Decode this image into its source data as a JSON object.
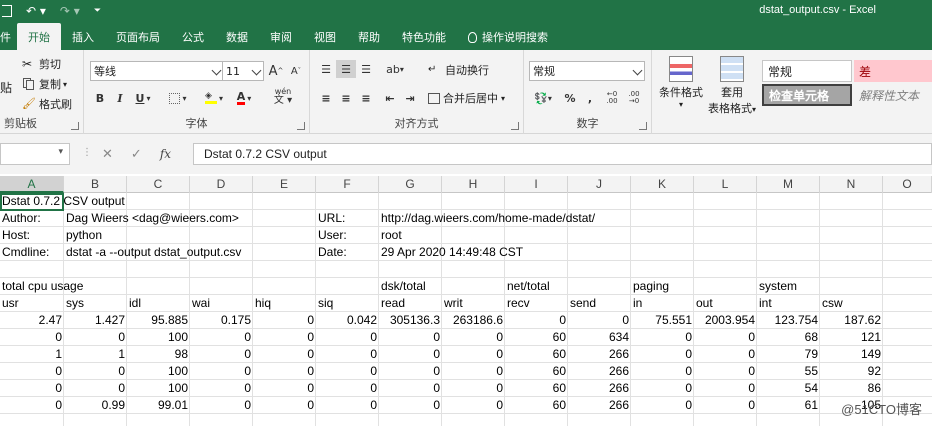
{
  "app": {
    "window_title": "dstat_output.csv - Excel",
    "qat_save_icon": "save-icon",
    "qat_undo_icon": "undo-icon",
    "qat_redo_icon": "redo-icon"
  },
  "tabs": [
    "件",
    "开始",
    "插入",
    "页面布局",
    "公式",
    "数据",
    "审阅",
    "视图",
    "帮助",
    "特色功能",
    "操作说明搜索"
  ],
  "ribbon": {
    "clipboard": {
      "paste": "贴",
      "cut": "剪切",
      "copy": "复制",
      "format_painter": "格式刷",
      "label": "剪贴板"
    },
    "font": {
      "name": "等线",
      "size": "11",
      "grow": "A",
      "shrink": "A",
      "bold": "B",
      "italic": "I",
      "underline": "U",
      "font_color_letter": "A",
      "wen": "wén",
      "label": "字体"
    },
    "alignment": {
      "wrap": "自动换行",
      "merge": "合并后居中",
      "label": "对齐方式"
    },
    "number": {
      "format": "常规",
      "percent": "%",
      "comma": ",",
      "label": "数字"
    },
    "styles": {
      "conditional": "条件格式",
      "table_format_1": "套用",
      "table_format_2": "表格格式",
      "normal": "常规",
      "bad": "差",
      "check_cell": "检查单元格",
      "explanatory": "解释性文本"
    }
  },
  "formula_bar": {
    "fx": "fx",
    "cancel": "✕",
    "enter": "✓",
    "content": "Dstat 0.7.2 CSV output"
  },
  "columns": [
    "A",
    "B",
    "C",
    "D",
    "E",
    "F",
    "G",
    "H",
    "I",
    "J",
    "K",
    "L",
    "M",
    "N",
    "O"
  ],
  "rows": [
    {
      "cells": [
        {
          "c": 0,
          "t": "Dstat 0.7.2 CSV output"
        }
      ]
    },
    {
      "cells": [
        {
          "c": 0,
          "t": "Author:"
        },
        {
          "c": 1,
          "t": "Dag Wieers <dag@wieers.com>"
        },
        {
          "c": 5,
          "t": "URL:"
        },
        {
          "c": 6,
          "t": "http://dag.wieers.com/home-made/dstat/"
        }
      ]
    },
    {
      "cells": [
        {
          "c": 0,
          "t": "Host:"
        },
        {
          "c": 1,
          "t": "python"
        },
        {
          "c": 5,
          "t": "User:"
        },
        {
          "c": 6,
          "t": "root"
        }
      ]
    },
    {
      "cells": [
        {
          "c": 0,
          "t": "Cmdline:"
        },
        {
          "c": 1,
          "t": "dstat -a --output dstat_output.csv"
        },
        {
          "c": 5,
          "t": "Date:"
        },
        {
          "c": 6,
          "t": "29 Apr 2020 14:49:48 CST"
        }
      ]
    },
    {
      "cells": []
    },
    {
      "cells": [
        {
          "c": 0,
          "t": "total cpu usage"
        },
        {
          "c": 6,
          "t": "dsk/total"
        },
        {
          "c": 8,
          "t": "net/total"
        },
        {
          "c": 10,
          "t": "paging"
        },
        {
          "c": 12,
          "t": "system"
        }
      ]
    },
    {
      "cells": [
        {
          "c": 0,
          "t": "usr"
        },
        {
          "c": 1,
          "t": "sys"
        },
        {
          "c": 2,
          "t": "idl"
        },
        {
          "c": 3,
          "t": "wai"
        },
        {
          "c": 4,
          "t": "hiq"
        },
        {
          "c": 5,
          "t": "siq"
        },
        {
          "c": 6,
          "t": "read"
        },
        {
          "c": 7,
          "t": "writ"
        },
        {
          "c": 8,
          "t": "recv"
        },
        {
          "c": 9,
          "t": "send"
        },
        {
          "c": 10,
          "t": "in"
        },
        {
          "c": 11,
          "t": "out"
        },
        {
          "c": 12,
          "t": "int"
        },
        {
          "c": 13,
          "t": "csw"
        }
      ]
    },
    {
      "num": true,
      "cells": [
        {
          "c": 0,
          "t": "2.47"
        },
        {
          "c": 1,
          "t": "1.427"
        },
        {
          "c": 2,
          "t": "95.885"
        },
        {
          "c": 3,
          "t": "0.175"
        },
        {
          "c": 4,
          "t": "0"
        },
        {
          "c": 5,
          "t": "0.042"
        },
        {
          "c": 6,
          "t": "305136.3"
        },
        {
          "c": 7,
          "t": "263186.6"
        },
        {
          "c": 8,
          "t": "0"
        },
        {
          "c": 9,
          "t": "0"
        },
        {
          "c": 10,
          "t": "75.551"
        },
        {
          "c": 11,
          "t": "2003.954"
        },
        {
          "c": 12,
          "t": "123.754"
        },
        {
          "c": 13,
          "t": "187.62"
        }
      ]
    },
    {
      "num": true,
      "cells": [
        {
          "c": 0,
          "t": "0"
        },
        {
          "c": 1,
          "t": "0"
        },
        {
          "c": 2,
          "t": "100"
        },
        {
          "c": 3,
          "t": "0"
        },
        {
          "c": 4,
          "t": "0"
        },
        {
          "c": 5,
          "t": "0"
        },
        {
          "c": 6,
          "t": "0"
        },
        {
          "c": 7,
          "t": "0"
        },
        {
          "c": 8,
          "t": "60"
        },
        {
          "c": 9,
          "t": "634"
        },
        {
          "c": 10,
          "t": "0"
        },
        {
          "c": 11,
          "t": "0"
        },
        {
          "c": 12,
          "t": "68"
        },
        {
          "c": 13,
          "t": "121"
        }
      ]
    },
    {
      "num": true,
      "cells": [
        {
          "c": 0,
          "t": "1"
        },
        {
          "c": 1,
          "t": "1"
        },
        {
          "c": 2,
          "t": "98"
        },
        {
          "c": 3,
          "t": "0"
        },
        {
          "c": 4,
          "t": "0"
        },
        {
          "c": 5,
          "t": "0"
        },
        {
          "c": 6,
          "t": "0"
        },
        {
          "c": 7,
          "t": "0"
        },
        {
          "c": 8,
          "t": "60"
        },
        {
          "c": 9,
          "t": "266"
        },
        {
          "c": 10,
          "t": "0"
        },
        {
          "c": 11,
          "t": "0"
        },
        {
          "c": 12,
          "t": "79"
        },
        {
          "c": 13,
          "t": "149"
        }
      ]
    },
    {
      "num": true,
      "cells": [
        {
          "c": 0,
          "t": "0"
        },
        {
          "c": 1,
          "t": "0"
        },
        {
          "c": 2,
          "t": "100"
        },
        {
          "c": 3,
          "t": "0"
        },
        {
          "c": 4,
          "t": "0"
        },
        {
          "c": 5,
          "t": "0"
        },
        {
          "c": 6,
          "t": "0"
        },
        {
          "c": 7,
          "t": "0"
        },
        {
          "c": 8,
          "t": "60"
        },
        {
          "c": 9,
          "t": "266"
        },
        {
          "c": 10,
          "t": "0"
        },
        {
          "c": 11,
          "t": "0"
        },
        {
          "c": 12,
          "t": "55"
        },
        {
          "c": 13,
          "t": "92"
        }
      ]
    },
    {
      "num": true,
      "cells": [
        {
          "c": 0,
          "t": "0"
        },
        {
          "c": 1,
          "t": "0"
        },
        {
          "c": 2,
          "t": "100"
        },
        {
          "c": 3,
          "t": "0"
        },
        {
          "c": 4,
          "t": "0"
        },
        {
          "c": 5,
          "t": "0"
        },
        {
          "c": 6,
          "t": "0"
        },
        {
          "c": 7,
          "t": "0"
        },
        {
          "c": 8,
          "t": "60"
        },
        {
          "c": 9,
          "t": "266"
        },
        {
          "c": 10,
          "t": "0"
        },
        {
          "c": 11,
          "t": "0"
        },
        {
          "c": 12,
          "t": "54"
        },
        {
          "c": 13,
          "t": "86"
        }
      ]
    },
    {
      "num": true,
      "cells": [
        {
          "c": 0,
          "t": "0"
        },
        {
          "c": 1,
          "t": "0.99"
        },
        {
          "c": 2,
          "t": "99.01"
        },
        {
          "c": 3,
          "t": "0"
        },
        {
          "c": 4,
          "t": "0"
        },
        {
          "c": 5,
          "t": "0"
        },
        {
          "c": 6,
          "t": "0"
        },
        {
          "c": 7,
          "t": "0"
        },
        {
          "c": 8,
          "t": "60"
        },
        {
          "c": 9,
          "t": "266"
        },
        {
          "c": 10,
          "t": "0"
        },
        {
          "c": 11,
          "t": "0"
        },
        {
          "c": 12,
          "t": "61"
        },
        {
          "c": 13,
          "t": "105"
        }
      ]
    },
    {
      "cells": []
    }
  ],
  "watermark": "@51CTO博客",
  "colors": {
    "excel_green": "#217346",
    "bad_style_bg": "#ffc7ce",
    "bad_style_fg": "#9c0006",
    "check_cell_bg": "#a5a5a5"
  }
}
